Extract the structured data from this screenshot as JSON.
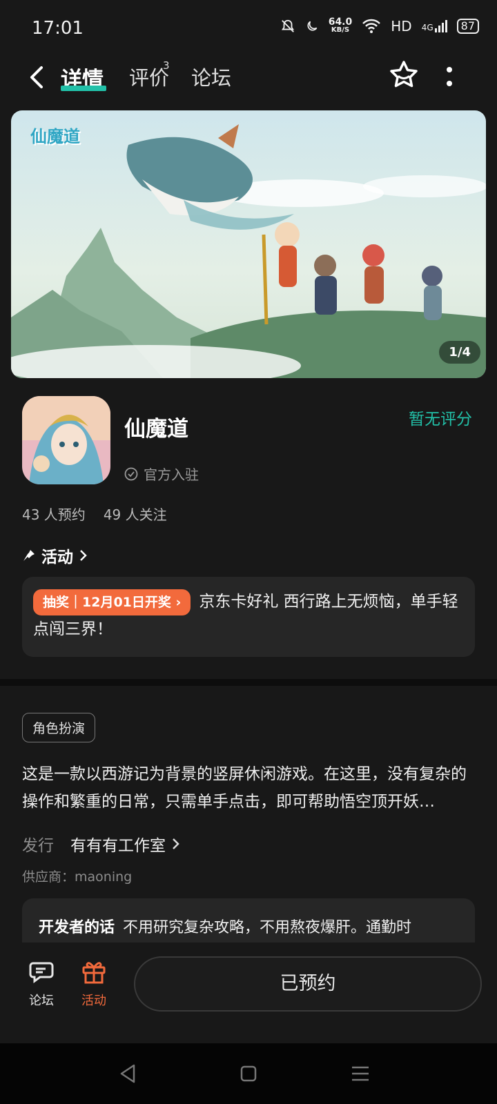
{
  "status_bar": {
    "time": "17:01",
    "speed_value": "64.0",
    "speed_unit": "KB/S",
    "hd": "HD",
    "signal": "4G",
    "battery": "87"
  },
  "header": {
    "tabs": [
      {
        "label": "详情",
        "active": true
      },
      {
        "label": "评价",
        "badge": "3"
      },
      {
        "label": "论坛"
      }
    ]
  },
  "banner": {
    "logo_text": "仙魔道",
    "pager": "1/4"
  },
  "app": {
    "name": "仙魔道",
    "official_label": "官方入驻",
    "rating_text": "暂无评分",
    "reservations": "43 人预约",
    "followers": "49 人关注"
  },
  "activity": {
    "section_title": "活动",
    "tag": "抽奖｜12月01日开奖",
    "text": "京东卡好礼 西行路上无烦恼，单手轻点闯三界！"
  },
  "details": {
    "genre": "角色扮演",
    "description": "这是一款以西游记为背景的竖屏休闲游戏。在这里，没有复杂的操作和繁重的日常，只需单手点击，即可帮助悟空顶开妖…",
    "publisher_label": "发行",
    "publisher_value": "有有有工作室",
    "supplier": "供应商：maoning",
    "developer_note_label": "开发者的话",
    "developer_note_text": "不用研究复杂攻略，不用熬夜爆肝。通勤时"
  },
  "bottom_bar": {
    "forum_label": "论坛",
    "activity_label": "活动",
    "reserve_button": "已预约"
  },
  "colors": {
    "accent": "#22c0a8",
    "orange": "#f26a3c",
    "background": "#181818"
  }
}
